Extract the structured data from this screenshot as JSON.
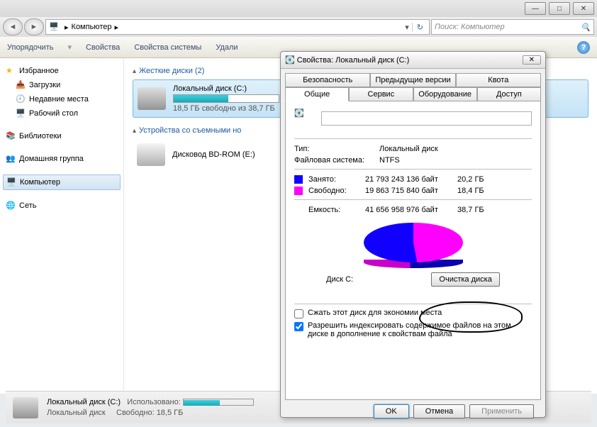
{
  "window": {
    "breadcrumb": "Компьютер",
    "search_placeholder": "Поиск: Компьютер"
  },
  "toolbar": {
    "organize": "Упорядочить",
    "properties": "Свойства",
    "sys_properties": "Свойства системы",
    "uninstall": "Удали"
  },
  "sidebar": {
    "favorites": "Избранное",
    "downloads": "Загрузки",
    "recent": "Недавние места",
    "desktop": "Рабочий стол",
    "libraries": "Библиотеки",
    "homegroup": "Домашняя группа",
    "computer": "Компьютер",
    "network": "Сеть"
  },
  "content": {
    "hdd_header": "Жесткие диски (2)",
    "drive_c_name": "Локальный диск (C:)",
    "drive_c_free": "18,5 ГБ свободно из 38,7 ГБ",
    "removable_header": "Устройства со съемными но",
    "bdrom": "Дисковод BD-ROM (E:)"
  },
  "status": {
    "name": "Локальный диск (C:)",
    "used_label": "Использовано:",
    "sub": "Локальный диск",
    "free_label": "Свободно:",
    "free_val": "18,5 ГБ"
  },
  "dlg": {
    "title": "Свойства: Локальный диск (C:)",
    "tabs_top": [
      "Безопасность",
      "Предыдущие версии",
      "Квота"
    ],
    "tabs_bot": [
      "Общие",
      "Сервис",
      "Оборудование",
      "Доступ"
    ],
    "type_l": "Тип:",
    "type_v": "Локальный диск",
    "fs_l": "Файловая система:",
    "fs_v": "NTFS",
    "used_l": "Занято:",
    "used_b": "21 793 243 136 байт",
    "used_g": "20,2 ГБ",
    "free_l": "Свободно:",
    "free_b": "19 863 715 840 байт",
    "free_g": "18,4 ГБ",
    "cap_l": "Емкость:",
    "cap_b": "41 656 958 976 байт",
    "cap_g": "38,7 ГБ",
    "disk_label": "Диск C:",
    "cleanup": "Очистка диска",
    "compress": "Сжать этот диск для экономии места",
    "index": "Разрешить индексировать содержимое файлов на этом диске в дополнение к свойствам файла",
    "ok": "OK",
    "cancel": "Отмена",
    "apply": "Применить"
  },
  "chart_data": {
    "type": "pie",
    "title": "Диск C:",
    "series": [
      {
        "name": "Занято",
        "value": 21793243136,
        "value_gb": 20.2,
        "color": "#1200ff"
      },
      {
        "name": "Свободно",
        "value": 19863715840,
        "value_gb": 18.4,
        "color": "#ff00ff"
      }
    ],
    "total": {
      "value": 41656958976,
      "value_gb": 38.7
    }
  }
}
